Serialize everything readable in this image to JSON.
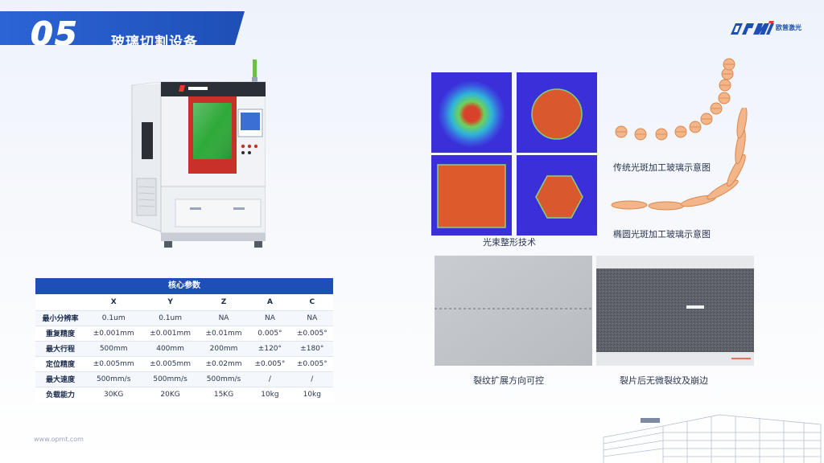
{
  "header": {
    "section_number": "05",
    "title": "玻璃切割设备"
  },
  "logo": {
    "brand_icon": "opmt-logo",
    "text": "欧普激光"
  },
  "machine_image": {
    "icon": "glass-cutting-machine-illustration"
  },
  "spec_table": {
    "caption": "核心参数",
    "columns": [
      "",
      "X",
      "Y",
      "Z",
      "A",
      "C"
    ],
    "rows": [
      {
        "label": "最小分辨率",
        "values": [
          "0.1um",
          "0.1um",
          "NA",
          "NA",
          "NA"
        ]
      },
      {
        "label": "重复精度",
        "values": [
          "±0.001mm",
          "±0.001mm",
          "±0.01mm",
          "0.005°",
          "±0.005°"
        ]
      },
      {
        "label": "最大行程",
        "values": [
          "500mm",
          "400mm",
          "200mm",
          "±120°",
          "±180°"
        ]
      },
      {
        "label": "定位精度",
        "values": [
          "±0.005mm",
          "±0.005mm",
          "±0.02mm",
          "±0.005°",
          "±0.005°"
        ]
      },
      {
        "label": "最大速度",
        "values": [
          "500mm/s",
          "500mm/s",
          "500mm/s",
          "/",
          "/"
        ]
      },
      {
        "label": "负载能力",
        "values": [
          "30KG",
          "20KG",
          "15KG",
          "10kg",
          "10kg"
        ]
      }
    ]
  },
  "beam_shaping": {
    "caption": "光束整形技术",
    "colors": {
      "background": "#3a2fd8",
      "spot": "#e0552a"
    }
  },
  "spot_diagrams": {
    "traditional_caption": "传统光斑加工玻璃示意图",
    "ellipse_caption": "椭圆光斑加工玻璃示意图",
    "spot_color": "#f0a878"
  },
  "crack_photos": {
    "controllable_caption": "裂纹扩展方向可控",
    "no_chipping_caption": "裂片后无微裂纹及崩边"
  },
  "footer": {
    "url": "www.opmt.com",
    "building_icon": "factory-building-sketch"
  }
}
